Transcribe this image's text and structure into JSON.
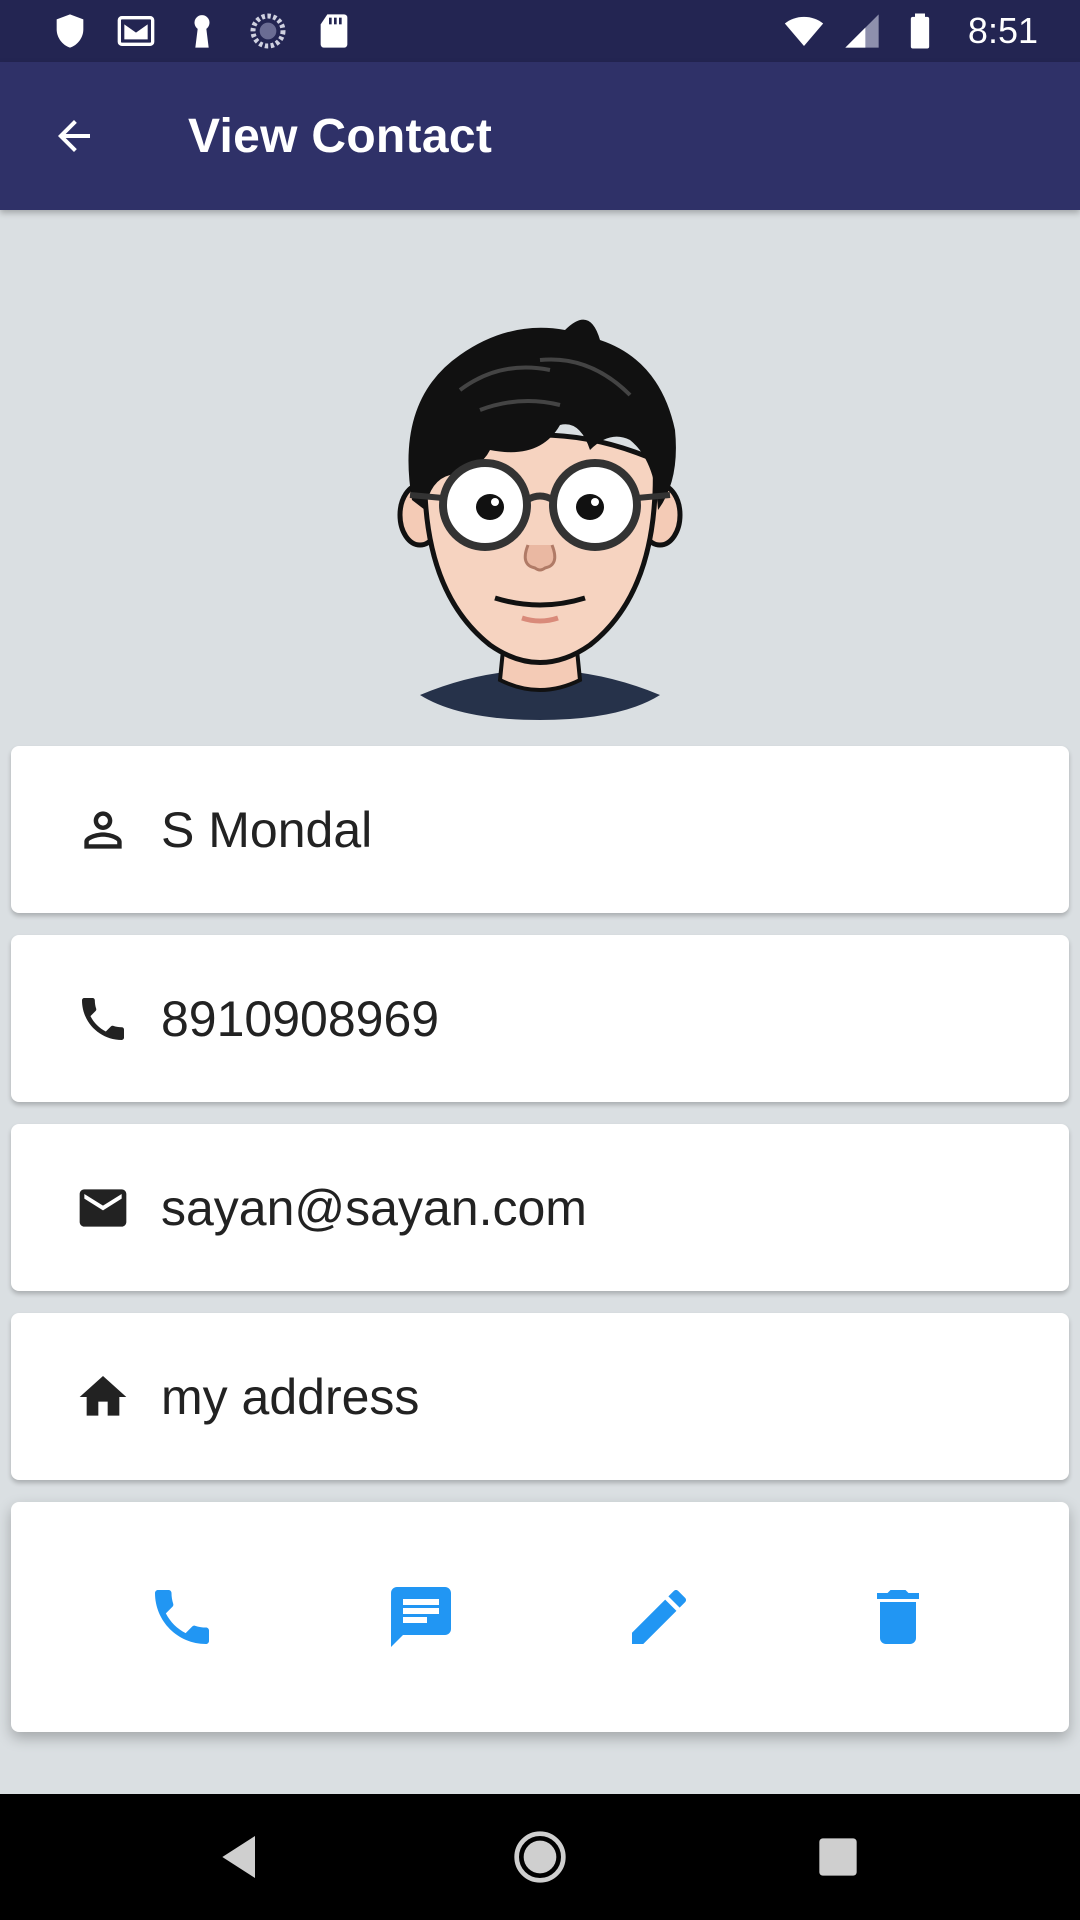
{
  "status_bar": {
    "time": "8:51",
    "left_icons": [
      "shield-icon",
      "gmail-icon",
      "keyhole-icon",
      "sync-icon",
      "sd-card-icon"
    ],
    "right_icons": [
      "wifi-icon",
      "cell-signal-icon",
      "battery-icon"
    ]
  },
  "app_bar": {
    "title": "View Contact",
    "back_icon": "arrow-back-icon",
    "background": "#2f3168"
  },
  "avatar": {
    "icon": "cartoon-avatar"
  },
  "contact": {
    "name": "S Mondal",
    "phone": "8910908969",
    "email": "sayan@sayan.com",
    "address": "my address"
  },
  "actions": [
    {
      "name": "call",
      "icon": "phone-icon"
    },
    {
      "name": "message",
      "icon": "message-icon"
    },
    {
      "name": "edit",
      "icon": "pencil-icon"
    },
    {
      "name": "delete",
      "icon": "trash-icon"
    }
  ],
  "colors": {
    "accent": "#2196f3",
    "status_bar": "#232552",
    "background": "#dadfe2"
  }
}
